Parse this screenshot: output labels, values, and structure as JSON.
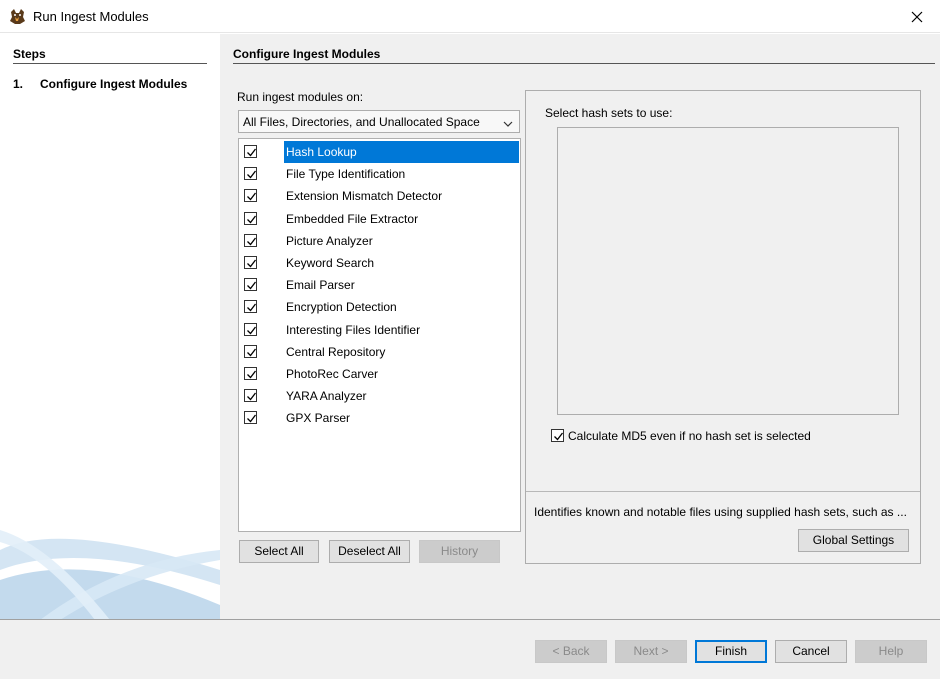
{
  "window": {
    "title": "Run Ingest Modules",
    "icon": "autopsy-dog-icon",
    "close_icon": "close-icon"
  },
  "steps": {
    "header": "Steps",
    "items": [
      {
        "number": "1.",
        "label": "Configure Ingest Modules"
      }
    ]
  },
  "main": {
    "header": "Configure Ingest Modules",
    "run_on_label": "Run ingest modules on:",
    "run_on_selected": "All Files, Directories, and Unallocated Space",
    "modules": [
      {
        "name": "Hash Lookup",
        "checked": true,
        "selected": true
      },
      {
        "name": "File Type Identification",
        "checked": true,
        "selected": false
      },
      {
        "name": "Extension Mismatch Detector",
        "checked": true,
        "selected": false
      },
      {
        "name": "Embedded File Extractor",
        "checked": true,
        "selected": false
      },
      {
        "name": "Picture Analyzer",
        "checked": true,
        "selected": false
      },
      {
        "name": "Keyword Search",
        "checked": true,
        "selected": false
      },
      {
        "name": "Email Parser",
        "checked": true,
        "selected": false
      },
      {
        "name": "Encryption Detection",
        "checked": true,
        "selected": false
      },
      {
        "name": "Interesting Files Identifier",
        "checked": true,
        "selected": false
      },
      {
        "name": "Central Repository",
        "checked": true,
        "selected": false
      },
      {
        "name": "PhotoRec Carver",
        "checked": true,
        "selected": false
      },
      {
        "name": "YARA Analyzer",
        "checked": true,
        "selected": false
      },
      {
        "name": "GPX Parser",
        "checked": true,
        "selected": false
      }
    ],
    "buttons": {
      "select_all": "Select All",
      "deselect_all": "Deselect All",
      "history": "History"
    }
  },
  "settings": {
    "hash_sets_label": "Select hash sets to use:",
    "calculate_md5_label": "Calculate MD5 even if no hash set is selected",
    "calculate_md5_checked": true,
    "description": "Identifies known and notable files using supplied hash sets, such as ...",
    "global_settings_label": "Global Settings"
  },
  "footer": {
    "back": "< Back",
    "next": "Next >",
    "finish": "Finish",
    "cancel": "Cancel",
    "help": "Help"
  },
  "colors": {
    "selection": "#0078d7",
    "panel_background": "#f0f0f0"
  }
}
